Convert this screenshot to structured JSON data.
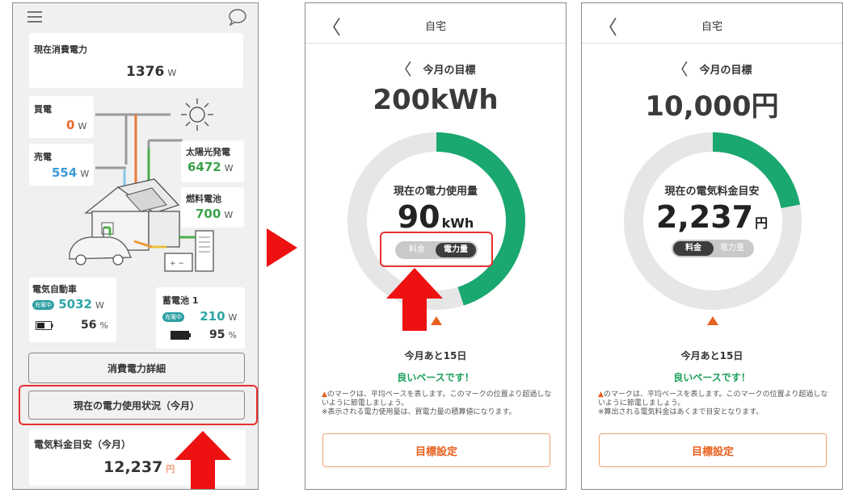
{
  "colors": {
    "accent_orange": "#e86a2e",
    "green": "#1aa05a",
    "ring_track": "#e6e6e6",
    "red_arrow": "#ee1111"
  },
  "screen1": {
    "menu_icon": "hamburger-icon",
    "chat_icon": "speech-bubble-icon",
    "current_power": {
      "label": "現在消費電力",
      "value": "1376",
      "unit": "W"
    },
    "buy": {
      "label": "買電",
      "value": "0",
      "unit": "W"
    },
    "sell": {
      "label": "売電",
      "value": "554",
      "unit": "W"
    },
    "solar": {
      "label": "太陽光発電",
      "value": "6472",
      "unit": "W"
    },
    "fuel_cell": {
      "label": "燃料電池",
      "value": "700",
      "unit": "W"
    },
    "ev": {
      "label": "電気自動車",
      "badge": "充電中",
      "value": "5032",
      "unit": "W",
      "battery": "56",
      "battery_unit": "%"
    },
    "storage": {
      "label": "蓄電池 1",
      "badge": "充電中",
      "value": "210",
      "unit": "W",
      "battery": "95",
      "battery_unit": "%"
    },
    "btn_detail": "消費電力詳細",
    "btn_usage": "現在の電力使用状況（今月）",
    "bill": {
      "label": "電気料金目安（今月）",
      "value": "12,237",
      "unit": "円"
    }
  },
  "screen2": {
    "title": "自宅",
    "goal_label": "今月の目標",
    "goal_value": "200kWh",
    "ring_label": "現在の電力使用量",
    "ring_value": "90",
    "ring_unit": "kWh",
    "progress": 0.45,
    "toggle": {
      "left": "料金",
      "right": "電力量",
      "active": "right"
    },
    "remaining": "今月あと15日",
    "pace": "良いペースです！",
    "note1": "のマークは、平均ペースを表します。このマークの位置より超過しないように節電しましょう。",
    "note2": "※表示される電力使用量は、買電力量の積算値になります。",
    "goal_button": "目標設定"
  },
  "screen3": {
    "title": "自宅",
    "goal_label": "今月の目標",
    "goal_value": "10,000円",
    "ring_label": "現在の電気料金目安",
    "ring_value": "2,237",
    "ring_unit": "円",
    "progress": 0.22,
    "toggle": {
      "left": "料金",
      "right": "電力量",
      "active": "left"
    },
    "remaining": "今月あと15日",
    "pace": "良いペースです！",
    "note1": "のマークは、平均ペースを表します。このマークの位置より超過しないように節電しましょう。",
    "note2": "※算出される電気料金はあくまで目安となります。",
    "goal_button": "目標設定"
  }
}
